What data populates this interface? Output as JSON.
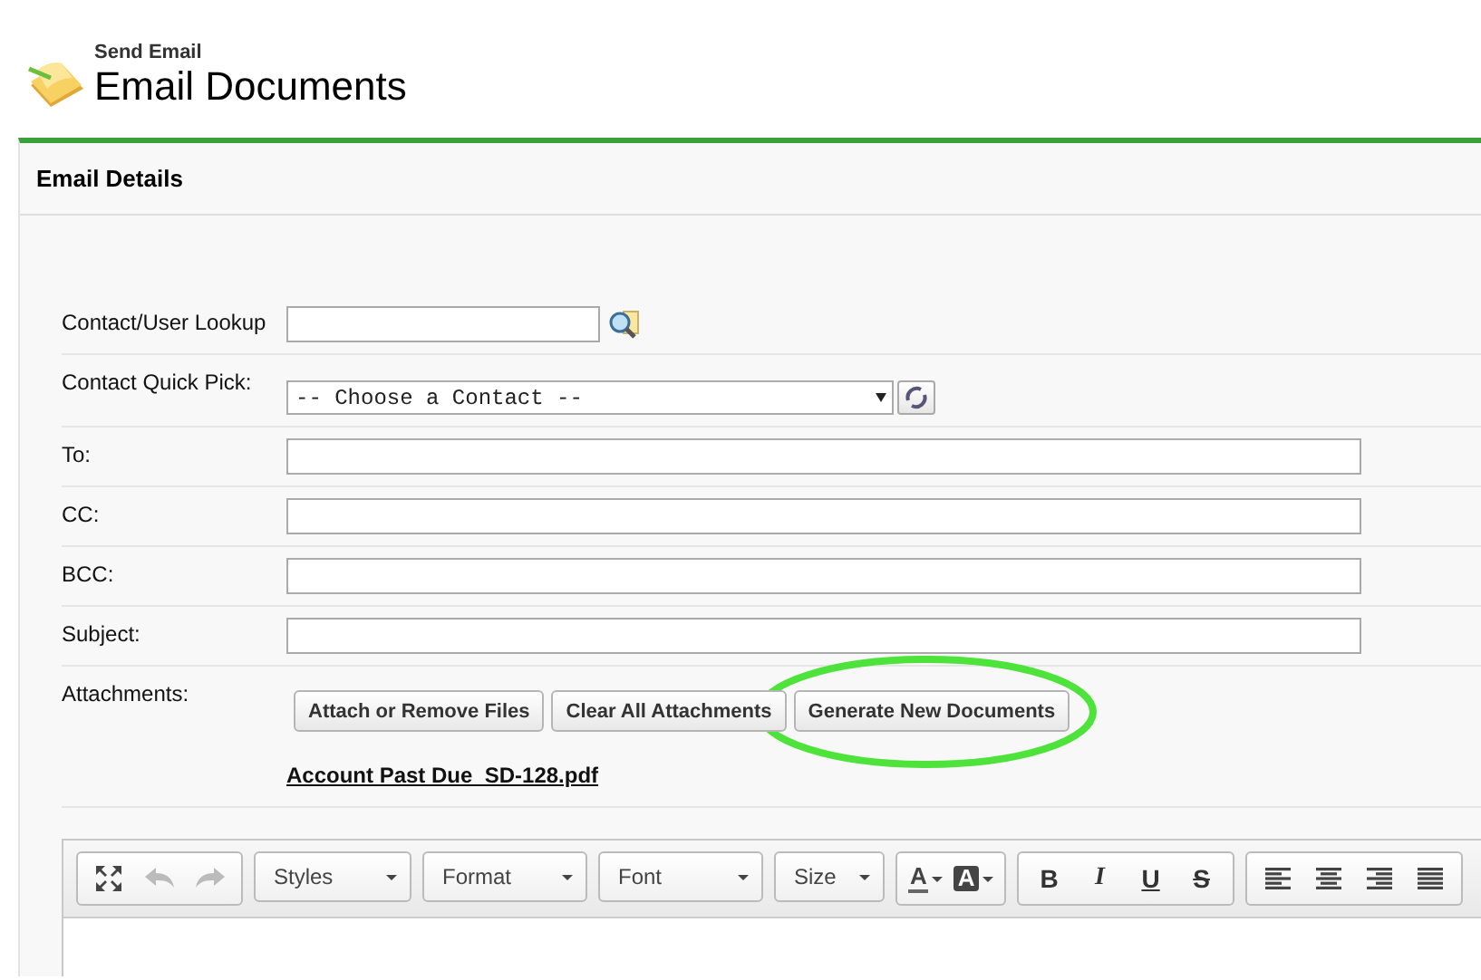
{
  "header": {
    "subtitle": "Send Email",
    "title": "Email Documents"
  },
  "panel": {
    "title": "Email Details"
  },
  "fields": [
    {
      "kind": "lookup",
      "label": "Contact/User Lookup"
    },
    {
      "kind": "select",
      "label": "Contact Quick Pick:",
      "value": "-- Choose a Contact --"
    },
    {
      "kind": "text",
      "label": "To:"
    },
    {
      "kind": "text",
      "label": "CC:"
    },
    {
      "kind": "text",
      "label": "BCC:"
    },
    {
      "kind": "text",
      "label": "Subject:"
    }
  ],
  "attachments": {
    "label": "Attachments:",
    "buttons": [
      {
        "label": "Attach or Remove Files",
        "highlighted": false
      },
      {
        "label": "Clear All Attachments",
        "highlighted": false
      },
      {
        "label": "Generate New Documents",
        "highlighted": true
      }
    ],
    "files": [
      "Account Past Due_SD-128.pdf"
    ]
  },
  "editor": {
    "toolbar": [
      {
        "kind": "tools",
        "items": [
          {
            "kind": "maximize",
            "disabled": false
          },
          {
            "kind": "undo",
            "disabled": true
          },
          {
            "kind": "redo",
            "disabled": true
          }
        ]
      },
      {
        "kind": "dropdown",
        "label": "Styles"
      },
      {
        "kind": "dropdown",
        "label": "Format"
      },
      {
        "kind": "dropdown",
        "label": "Font"
      },
      {
        "kind": "dropdown",
        "label": "Size"
      },
      {
        "kind": "colors",
        "items": [
          {
            "kind": "text",
            "label": "A"
          },
          {
            "kind": "background",
            "label": "A"
          }
        ]
      },
      {
        "kind": "formats",
        "items": [
          {
            "kind": "bold",
            "label": "B"
          },
          {
            "kind": "italic",
            "label": "I"
          },
          {
            "kind": "underline",
            "label": "U"
          },
          {
            "kind": "strike",
            "label": "S"
          }
        ]
      },
      {
        "kind": "align",
        "items": [
          {
            "kind": "left"
          },
          {
            "kind": "center"
          },
          {
            "kind": "right"
          },
          {
            "kind": "justify"
          }
        ]
      }
    ]
  }
}
